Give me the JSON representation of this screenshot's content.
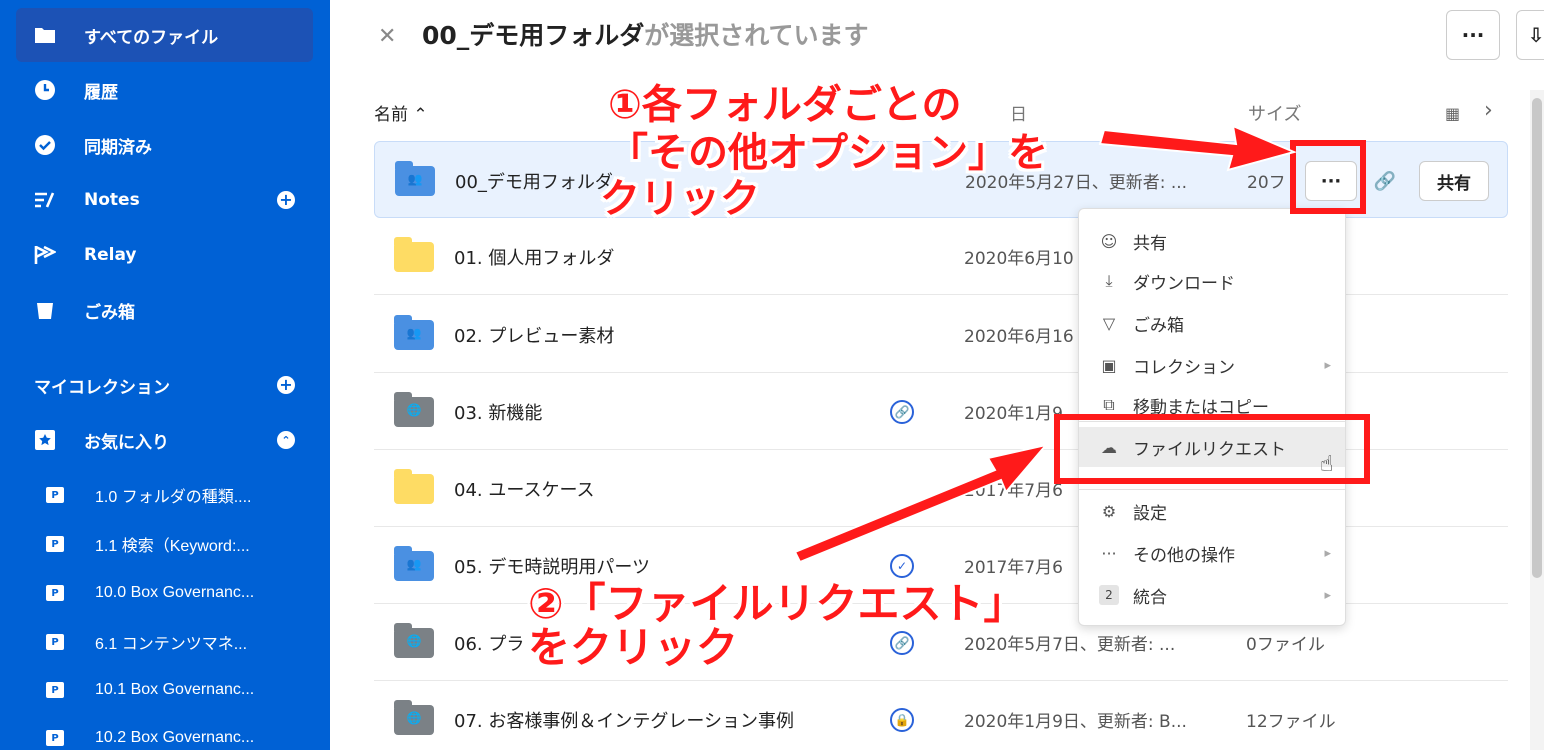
{
  "sidebar": {
    "items": [
      {
        "label": "すべてのファイル",
        "icon": "folder-icon"
      },
      {
        "label": "履歴",
        "icon": "clock-icon"
      },
      {
        "label": "同期済み",
        "icon": "check-circle-icon"
      },
      {
        "label": "Notes",
        "icon": "notes-icon"
      },
      {
        "label": "Relay",
        "icon": "relay-icon"
      },
      {
        "label": "ごみ箱",
        "icon": "trash-icon"
      }
    ],
    "my_collections": "マイコレクション",
    "favorites": "お気に入り",
    "favorite_items": [
      "1.0 フォルダの種類....",
      "1.1 検索（Keyword:...",
      "10.0 Box Governanc...",
      "6.1 コンテンツマネ...",
      "10.1 Box Governanc...",
      "10.2 Box Governanc..."
    ]
  },
  "header": {
    "selected_name": "00_デモ用フォルダ",
    "selected_suffix": "が選択されています",
    "more_label": "···",
    "download_label": "⇩"
  },
  "table": {
    "col_name": "名前 ⌃",
    "col_updated": "日",
    "col_size": "サイズ",
    "rows": [
      {
        "name": "00_デモ用フォルダ",
        "date": "2020年5月27日、更新者: ...",
        "size": "20フ"
      },
      {
        "name": "01. 個人用フォルダ",
        "date": "2020年6月10",
        "size": ""
      },
      {
        "name": "02. プレビュー素材",
        "date": "2020年6月16",
        "size": ""
      },
      {
        "name": "03. 新機能",
        "date": "2020年1月9",
        "size": ""
      },
      {
        "name": "04. ユースケース",
        "date": "2017年7月6",
        "size": ""
      },
      {
        "name": "05. デモ時説明用パーツ",
        "date": "2017年7月6",
        "size": ""
      },
      {
        "name": "06. プラ",
        "date": "2020年5月7日、更新者: ...",
        "size": "0ファイル"
      },
      {
        "name": "07. お客様事例＆インテグレーション事例",
        "date": "2020年1月9日、更新者: B...",
        "size": "12ファイル"
      }
    ],
    "more_btn": "···",
    "share_btn": "共有"
  },
  "menu": {
    "items": [
      {
        "label": "共有",
        "icon": "share-icon"
      },
      {
        "label": "ダウンロード",
        "icon": "download-icon"
      },
      {
        "label": "ごみ箱",
        "icon": "trash-icon"
      },
      {
        "label": "コレクション",
        "icon": "collection-icon"
      },
      {
        "label": "移動またはコピー",
        "icon": "copy-icon"
      },
      {
        "label": "ファイルリクエスト",
        "icon": "cloud-upload-icon"
      },
      {
        "label": "設定",
        "icon": "gear-icon"
      },
      {
        "label": "その他の操作",
        "icon": "more-icon"
      },
      {
        "label": "統合",
        "icon": "integration-icon"
      }
    ],
    "integration_count": "2"
  },
  "annotations": {
    "step1_line1": "①各フォルダごとの",
    "step1_line2": "「その他オプション」を",
    "step1_line3": "クリック",
    "step2_line1": "②「ファイルリクエスト」",
    "step2_line2": "をクリック"
  },
  "colors": {
    "sidebar_bg": "#0061d5",
    "annotation_red": "#ff1a1a",
    "selected_row_bg": "#e9f2fe"
  }
}
